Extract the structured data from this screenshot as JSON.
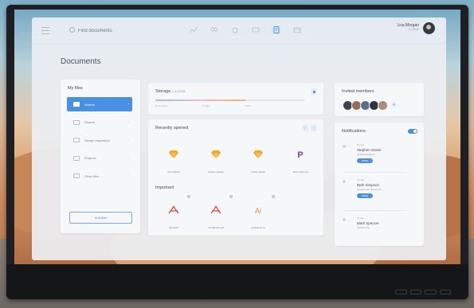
{
  "header": {
    "search_placeholder": "Find documents",
    "user_name": "Lisa Morgan",
    "user_sub": "● Online"
  },
  "page_title": "Documents",
  "my_files": {
    "title": "My files",
    "items": [
      {
        "label": "Shared",
        "active": true
      },
      {
        "label": "Shared",
        "active": false
      },
      {
        "label": "Design inspiration",
        "active": false
      },
      {
        "label": "Projects",
        "active": false
      },
      {
        "label": "Other files",
        "active": false
      }
    ],
    "add_button": "Add files"
  },
  "storage": {
    "title": "Storage",
    "value": "1.4/20GB",
    "used_fraction": 0.6,
    "labels": [
      "Documents",
      "Images",
      "Video"
    ]
  },
  "recently_opened": {
    "title": "Recently opened",
    "pager_prev": "‹",
    "pager_next": "›",
    "docs": [
      {
        "caption": "UI kit.sketch",
        "kind": "sketch"
      },
      {
        "caption": "desktop.sketch",
        "kind": "sketch"
      },
      {
        "caption": "mobile.sketch",
        "kind": "sketch"
      },
      {
        "caption": "Web_final.psd",
        "kind": "psd"
      }
    ]
  },
  "important": {
    "title": "Important",
    "docs": [
      {
        "caption": "Brief.pdf",
        "kind": "pdf"
      },
      {
        "caption": "moodboard.pdf",
        "kind": "pdf"
      },
      {
        "caption": "guidelines.ai",
        "kind": "ai"
      }
    ]
  },
  "invited_members": {
    "title": "Invited members",
    "avatar_colors": [
      "#3b4252",
      "#9c6b55",
      "#5a6f8a",
      "#2e3440",
      "#b08a7a"
    ],
    "plus": "+"
  },
  "notifications": {
    "title": "Notifications",
    "enabled": true,
    "items": [
      {
        "time": "2h ago",
        "who": "Stephen Green",
        "what": "added 5 pictures",
        "button": "OPEN"
      },
      {
        "time": "3h ago",
        "who": "Beth Simpson",
        "what": "created new document",
        "button": "OPEN"
      },
      {
        "time": "5h ago",
        "who": "Mark Spencer",
        "what": "shared a file",
        "button": "OPEN"
      }
    ]
  }
}
